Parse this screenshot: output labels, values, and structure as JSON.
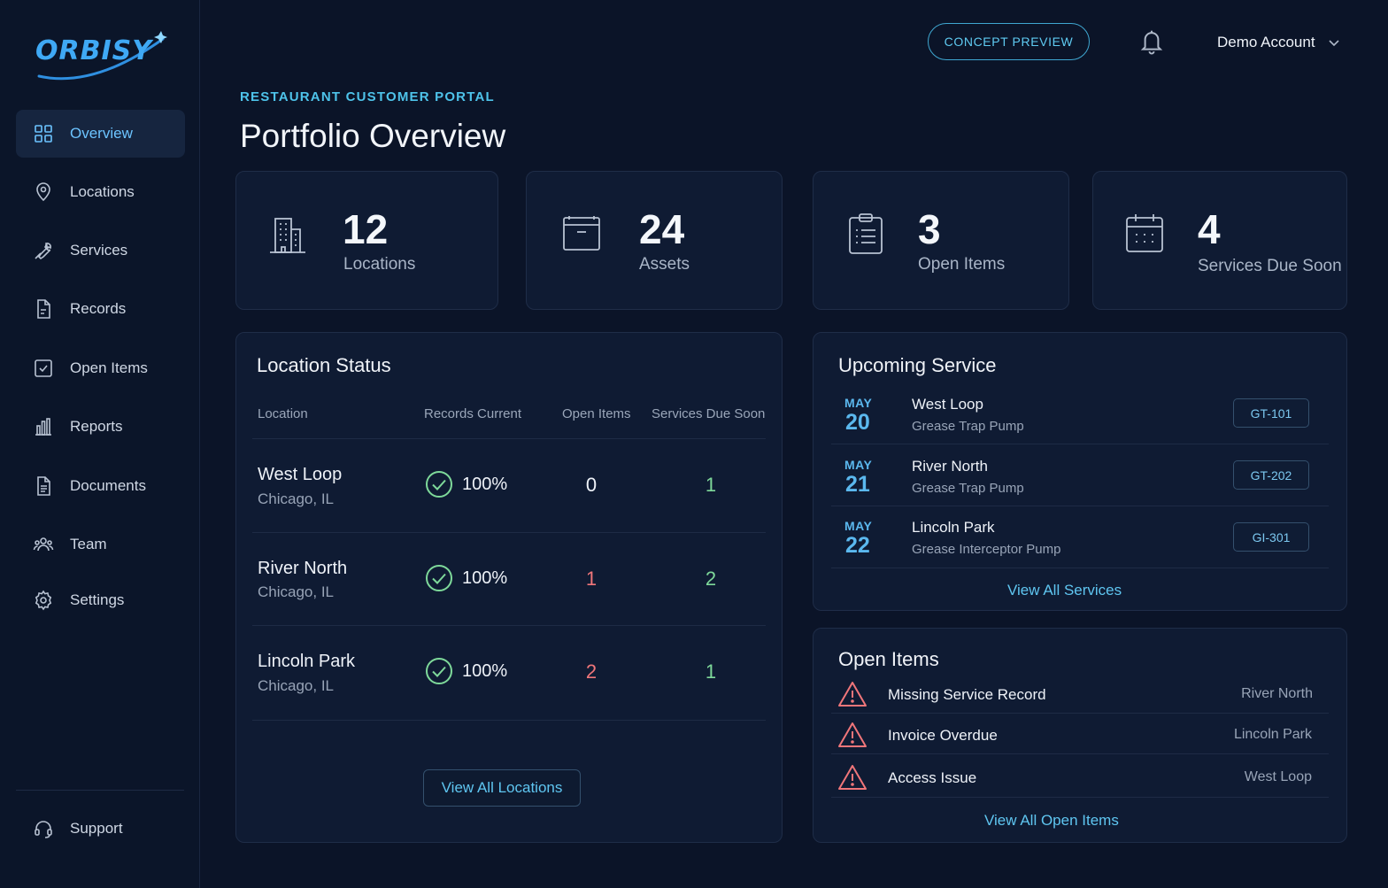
{
  "brand": {
    "name": "ORBISY"
  },
  "sidebar": {
    "items": [
      {
        "label": "Overview",
        "icon": "grid-icon"
      },
      {
        "label": "Locations",
        "icon": "map-pin-icon"
      },
      {
        "label": "Services",
        "icon": "wrench-icon"
      },
      {
        "label": "Records",
        "icon": "file-icon"
      },
      {
        "label": "Open Items",
        "icon": "checkbox-icon"
      },
      {
        "label": "Reports",
        "icon": "bar-chart-icon"
      },
      {
        "label": "Documents",
        "icon": "document-icon"
      },
      {
        "label": "Team",
        "icon": "team-icon"
      },
      {
        "label": "Settings",
        "icon": "gear-icon"
      }
    ],
    "support": {
      "label": "Support",
      "icon": "headset-icon"
    }
  },
  "header": {
    "concept_label": "CONCEPT PREVIEW",
    "account_label": "Demo Account"
  },
  "page": {
    "eyebrow": "RESTAURANT CUSTOMER PORTAL",
    "title": "Portfolio Overview"
  },
  "stats": [
    {
      "value": "12",
      "label": "Locations",
      "icon": "building-icon"
    },
    {
      "value": "24",
      "label": "Assets",
      "icon": "archive-box-icon"
    },
    {
      "value": "3",
      "label": "Open Items",
      "icon": "clipboard-icon"
    },
    {
      "value": "4",
      "label": "Services Due Soon",
      "icon": "calendar-icon"
    }
  ],
  "location_status": {
    "title": "Location Status",
    "columns": [
      "Location",
      "Records Current",
      "Open Items",
      "Services Due Soon"
    ],
    "rows": [
      {
        "name": "West Loop",
        "city": "Chicago, IL",
        "records": "100%",
        "open": "0",
        "due": "1"
      },
      {
        "name": "River North",
        "city": "Chicago, IL",
        "records": "100%",
        "open": "1",
        "due": "2"
      },
      {
        "name": "Lincoln Park",
        "city": "Chicago, IL",
        "records": "100%",
        "open": "2",
        "due": "1"
      }
    ],
    "button_label": "View All Locations"
  },
  "upcoming": {
    "title": "Upcoming Service",
    "items": [
      {
        "month": "MAY",
        "day": "20",
        "name": "West Loop",
        "service": "Grease Trap Pump",
        "tag": "GT-101"
      },
      {
        "month": "MAY",
        "day": "21",
        "name": "River North",
        "service": "Grease Trap Pump",
        "tag": "GT-202"
      },
      {
        "month": "MAY",
        "day": "22",
        "name": "Lincoln Park",
        "service": "Grease Interceptor Pump",
        "tag": "GI-301"
      }
    ],
    "link_label": "View All Services"
  },
  "open_items": {
    "title": "Open Items",
    "items": [
      {
        "name": "Missing Service Record",
        "location": "River North"
      },
      {
        "name": "Invoice Overdue",
        "location": "Lincoln Park"
      },
      {
        "name": "Access Issue",
        "location": "West Loop"
      }
    ],
    "link_label": "View All Open Items"
  },
  "colors": {
    "accent": "#5fc6f1",
    "success": "#7ed99a",
    "danger": "#f0767a",
    "background": "#0b1428",
    "card": "#0f1b33"
  }
}
